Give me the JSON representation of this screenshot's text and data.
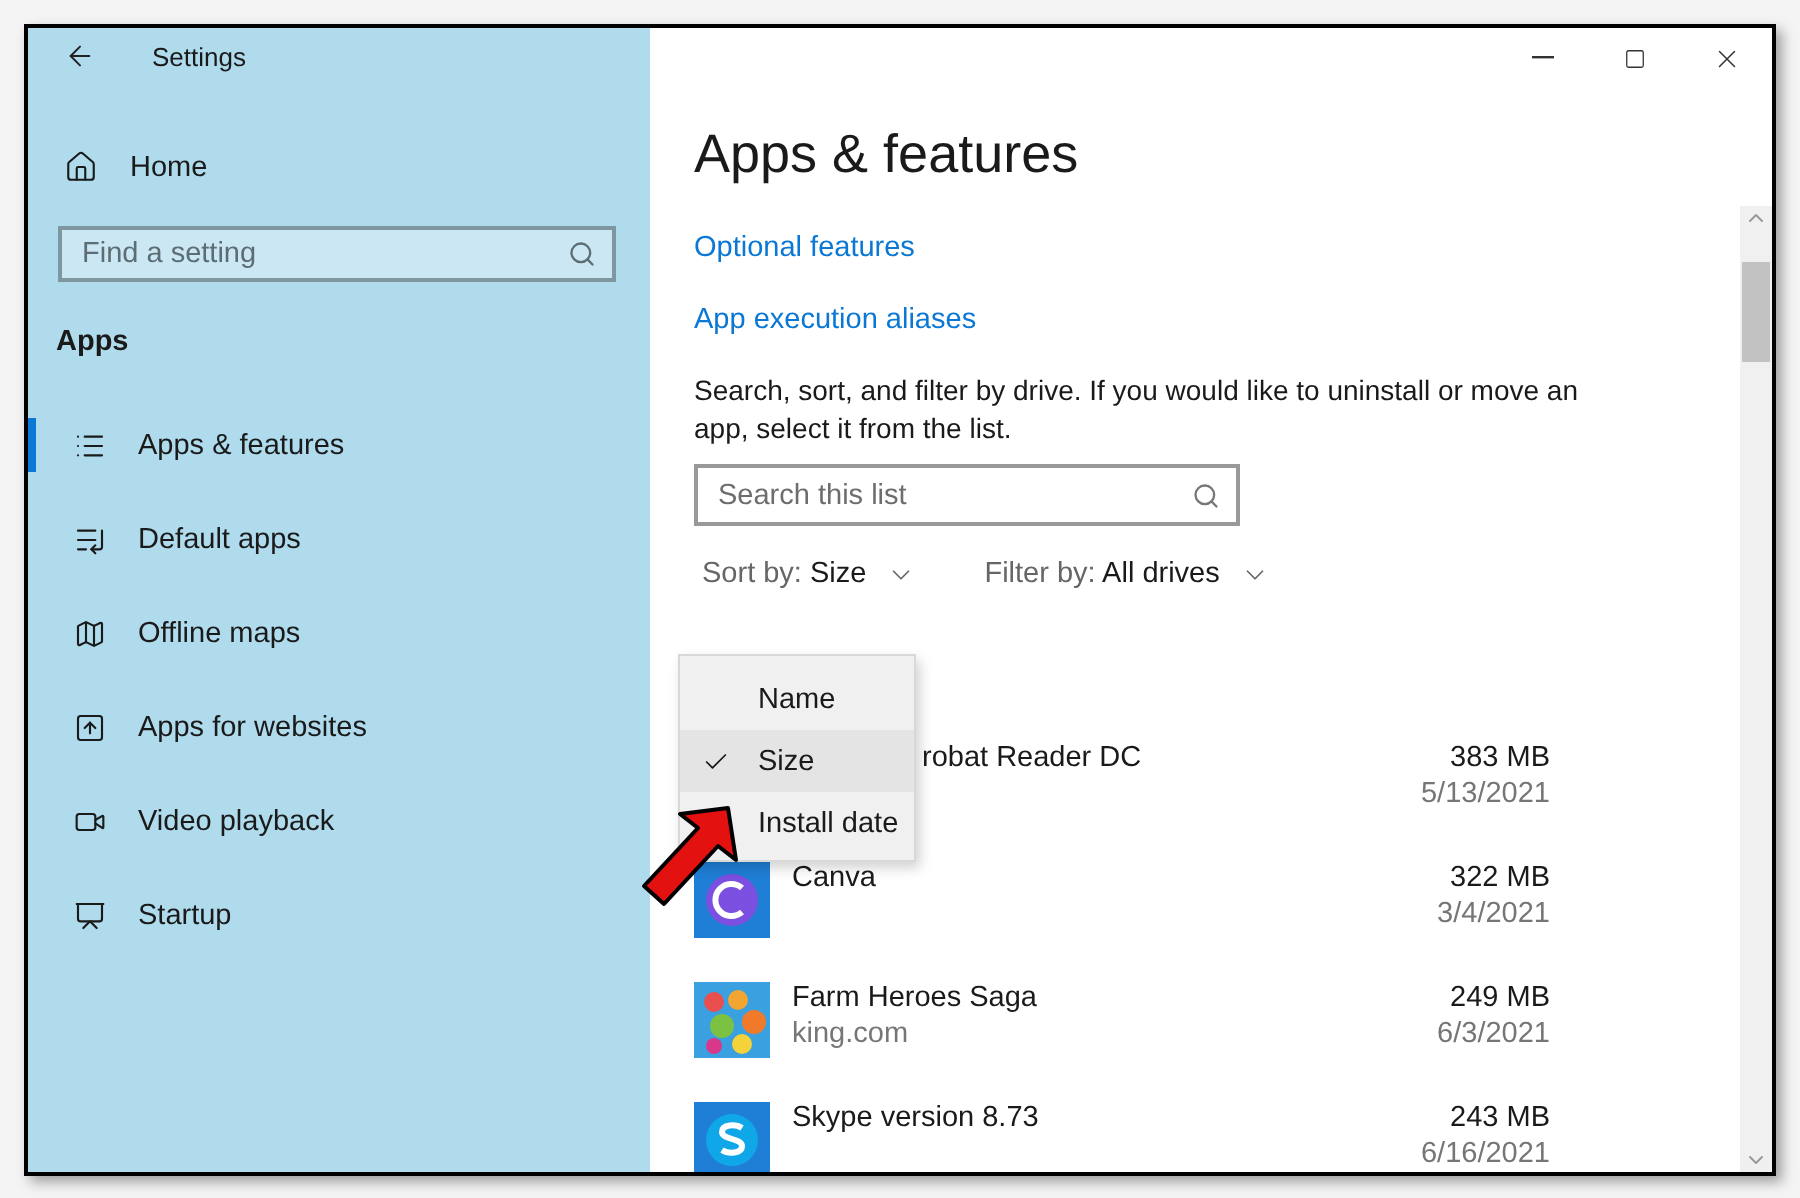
{
  "window": {
    "title": "Settings"
  },
  "sidebar": {
    "home": "Home",
    "search": {
      "placeholder": "Find a setting"
    },
    "section": "Apps",
    "items": [
      {
        "label": "Apps & features",
        "kind": "list",
        "selected": true
      },
      {
        "label": "Default apps",
        "kind": "default",
        "selected": false
      },
      {
        "label": "Offline maps",
        "kind": "map",
        "selected": false
      },
      {
        "label": "Apps for websites",
        "kind": "web",
        "selected": false
      },
      {
        "label": "Video playback",
        "kind": "video",
        "selected": false
      },
      {
        "label": "Startup",
        "kind": "startup",
        "selected": false
      }
    ]
  },
  "page": {
    "title": "Apps & features",
    "links": [
      "Optional features",
      "App execution aliases"
    ],
    "description": "Search, sort, and filter by drive. If you would like to uninstall or move an app, select it from the list.",
    "search": {
      "placeholder": "Search this list"
    },
    "sort": {
      "label": "Sort by:",
      "value": "Size"
    },
    "filter": {
      "label": "Filter by:",
      "value": "All drives"
    },
    "sort_menu": [
      {
        "label": "Name",
        "selected": false
      },
      {
        "label": "Size",
        "selected": true
      },
      {
        "label": "Install date",
        "selected": false
      }
    ],
    "apps": [
      {
        "name": "robat Reader DC",
        "kind": "covered",
        "size": "383 MB",
        "date": "5/13/2021"
      },
      {
        "name": "Canva",
        "kind": "canva",
        "size": "322 MB",
        "date": "3/4/2021"
      },
      {
        "name": "Farm Heroes Saga",
        "kind": "farm",
        "publisher": "king.com",
        "size": "249 MB",
        "date": "6/3/2021"
      },
      {
        "name": "Skype version 8.73",
        "kind": "skype",
        "size": "243 MB",
        "date": "6/16/2021"
      }
    ]
  }
}
